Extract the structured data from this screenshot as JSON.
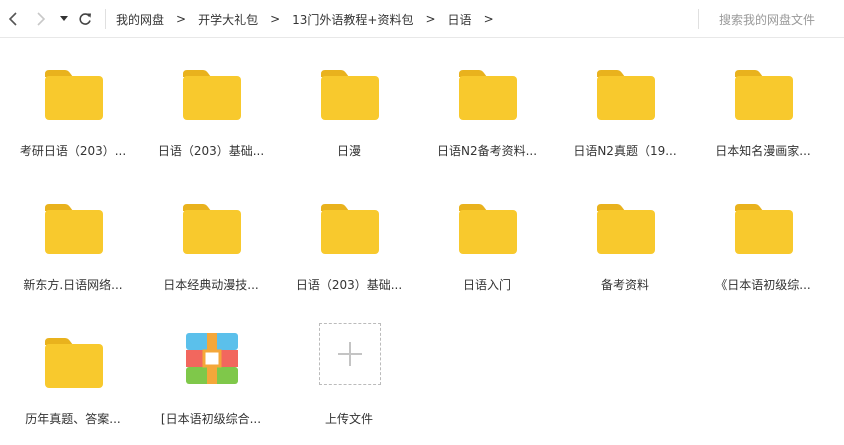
{
  "nav": {
    "back_icon": "chevron-left-icon",
    "forward_icon": "chevron-right-icon",
    "history_icon": "caret-down-icon",
    "refresh_icon": "refresh-icon"
  },
  "breadcrumb": {
    "items": [
      "我的网盘",
      "开学大礼包",
      "13门外语教程+资料包",
      "日语"
    ],
    "separator": ">"
  },
  "search": {
    "placeholder": "搜索我的网盘文件"
  },
  "colors": {
    "folder": "#F8C92D",
    "folder_tab": "#E9B21D"
  },
  "files": [
    {
      "name": "考研日语（203）...",
      "type": "folder"
    },
    {
      "name": "日语（203）基础...",
      "type": "folder"
    },
    {
      "name": "日漫",
      "type": "folder"
    },
    {
      "name": "日语N2备考资料...",
      "type": "folder"
    },
    {
      "name": "日语N2真题（19...",
      "type": "folder"
    },
    {
      "name": "日本知名漫画家...",
      "type": "folder"
    },
    {
      "name": "新东方.日语网络...",
      "type": "folder"
    },
    {
      "name": "日本经典动漫技...",
      "type": "folder"
    },
    {
      "name": "日语（203）基础...",
      "type": "folder"
    },
    {
      "name": "日语入门",
      "type": "folder"
    },
    {
      "name": "备考资料",
      "type": "folder"
    },
    {
      "name": "《日本语初级综...",
      "type": "folder"
    },
    {
      "name": "历年真题、答案...",
      "type": "folder"
    },
    {
      "name": "[日本语初级综合...",
      "type": "archive"
    }
  ],
  "upload": {
    "label": "上传文件",
    "icon": "plus-icon"
  }
}
